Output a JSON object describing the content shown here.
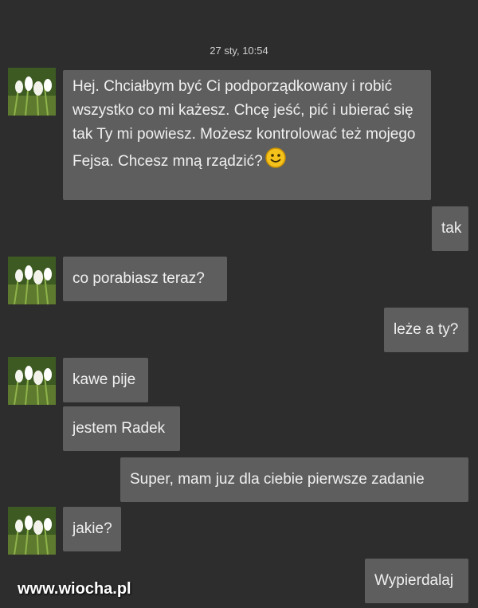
{
  "conversation": {
    "timestamp": "27 sty, 10:54",
    "messages": [
      {
        "direction": "in",
        "text": "Hej. Chciałbym być Ci podporządkowany i robić wszystko co mi każesz.  Chcę jeść, pić i ubierać się tak Ty mi powiesz. Możesz kontrolować też  mojego Fejsa. Chcesz mną rządzić?",
        "emoji": "smiley-icon"
      },
      {
        "direction": "out",
        "text": "tak"
      },
      {
        "direction": "in",
        "text": "co porabiasz teraz?"
      },
      {
        "direction": "out",
        "text": "leże a ty?"
      },
      {
        "direction": "in",
        "text": "kawe pije"
      },
      {
        "direction": "in",
        "text": "jestem Radek"
      },
      {
        "direction": "out",
        "text": "Super, mam juz dla ciebie pierwsze zadanie"
      },
      {
        "direction": "in",
        "text": "jakie?"
      },
      {
        "direction": "out",
        "text": "Wypierdalaj"
      }
    ]
  },
  "watermark": "www.wiocha.pl",
  "colors": {
    "background": "#2d2d2d",
    "bubble": "#5e5e5e",
    "text": "#f0f0f0"
  }
}
